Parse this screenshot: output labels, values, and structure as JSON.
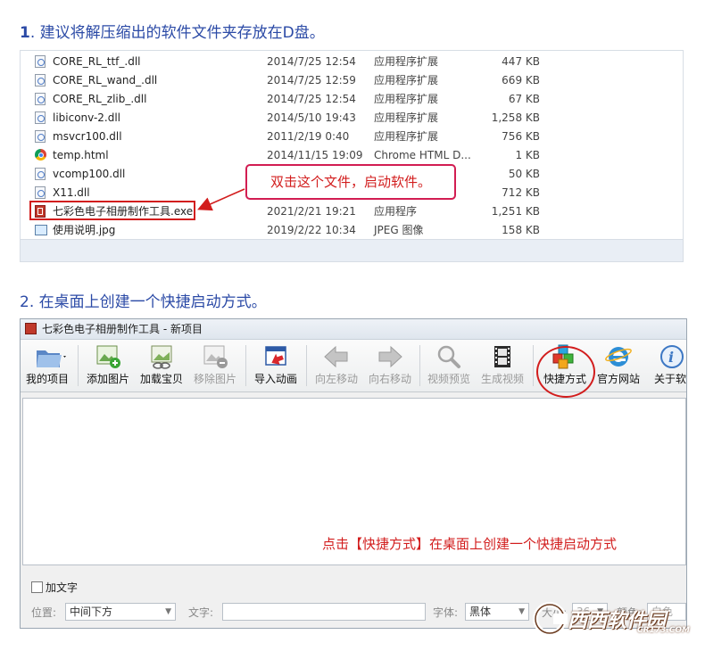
{
  "step1": {
    "num": "1",
    "text": ". 建议将解压缩出的软件文件夹存放在D盘。"
  },
  "files": [
    {
      "name": "CORE_RL_ttf_.dll",
      "date": "2014/7/25 12:54",
      "type": "应用程序扩展",
      "size": "447 KB",
      "icon": "dll-file-icon"
    },
    {
      "name": "CORE_RL_wand_.dll",
      "date": "2014/7/25 12:59",
      "type": "应用程序扩展",
      "size": "669 KB",
      "icon": "dll-file-icon"
    },
    {
      "name": "CORE_RL_zlib_.dll",
      "date": "2014/7/25 12:54",
      "type": "应用程序扩展",
      "size": "67 KB",
      "icon": "dll-file-icon"
    },
    {
      "name": "libiconv-2.dll",
      "date": "2014/5/10 19:43",
      "type": "应用程序扩展",
      "size": "1,258 KB",
      "icon": "dll-file-icon"
    },
    {
      "name": "msvcr100.dll",
      "date": "2011/2/19 0:40",
      "type": "应用程序扩展",
      "size": "756 KB",
      "icon": "dll-file-icon"
    },
    {
      "name": "temp.html",
      "date": "2014/11/15 19:09",
      "type": "Chrome HTML D...",
      "size": "1 KB",
      "icon": "chrome-icon"
    },
    {
      "name": "vcomp100.dll",
      "date": "",
      "type": "",
      "size": "50 KB",
      "icon": "dll-file-icon"
    },
    {
      "name": "X11.dll",
      "date": "",
      "type": "",
      "size": "712 KB",
      "icon": "dll-file-icon"
    },
    {
      "name": "七彩色电子相册制作工具.exe",
      "date": "2021/2/21 19:21",
      "type": "应用程序",
      "size": "1,251 KB",
      "icon": "exe-app-icon"
    },
    {
      "name": "使用说明.jpg",
      "date": "2019/2/22 10:34",
      "type": "JPEG 图像",
      "size": "158 KB",
      "icon": "jpg-image-icon"
    }
  ],
  "callout1": "双击这个文件，启动软件。",
  "step2": {
    "text": "2. 在桌面上创建一个快捷启动方式。"
  },
  "app": {
    "title": "七彩色电子相册制作工具 - 新项目",
    "toolbar": [
      {
        "label": "我的项目",
        "icon": "folder-icon",
        "enabled": true
      },
      {
        "label": "添加图片",
        "icon": "add-image-icon",
        "enabled": true
      },
      {
        "label": "加载宝贝",
        "icon": "load-item-icon",
        "enabled": true
      },
      {
        "label": "移除图片",
        "icon": "remove-image-icon",
        "enabled": false
      },
      {
        "label": "导入动画",
        "icon": "import-animation-icon",
        "enabled": true
      },
      {
        "label": "向左移动",
        "icon": "arrow-left-icon",
        "enabled": false
      },
      {
        "label": "向右移动",
        "icon": "arrow-right-icon",
        "enabled": false
      },
      {
        "label": "视频预览",
        "icon": "magnifier-icon",
        "enabled": false
      },
      {
        "label": "生成视频",
        "icon": "film-icon",
        "enabled": false
      },
      {
        "label": "快捷方式",
        "icon": "shortcut-cubes-icon",
        "enabled": true
      },
      {
        "label": "官方网站",
        "icon": "ie-browser-icon",
        "enabled": true
      },
      {
        "label": "关于软",
        "icon": "info-icon",
        "enabled": true
      }
    ],
    "hint": "点击【快捷方式】在桌面上创建一个快捷启动方式",
    "addtext_label": "加文字",
    "position_label": "位置:",
    "position_value": "中间下方",
    "text_label": "文字:",
    "font_label": "字体:",
    "font_value": "黑体",
    "size_label": "大小:",
    "size_value": "36",
    "color_label": "颜色:",
    "color_value": "白色"
  },
  "watermark": {
    "brand": "西西软件园",
    "url": "CR173.COM"
  },
  "colors": {
    "accent_red": "#d21d1d",
    "title_blue": "#2b4aa6"
  }
}
